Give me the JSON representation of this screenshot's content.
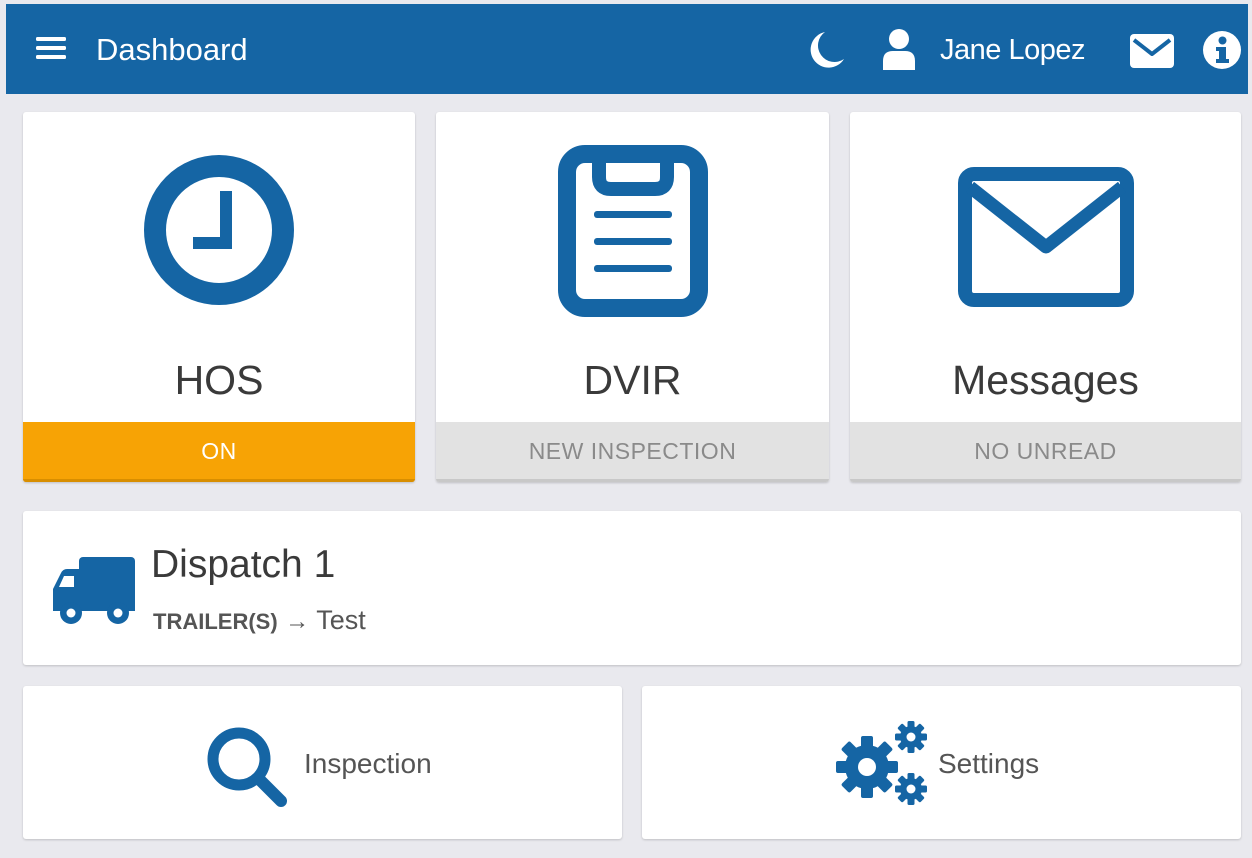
{
  "header": {
    "title": "Dashboard",
    "user_name": "Jane Lopez",
    "background_color": "#1565a4",
    "icons": [
      "menu-icon",
      "moon-icon",
      "user-icon",
      "envelope-icon",
      "info-icon"
    ]
  },
  "tiles": [
    {
      "label": "HOS",
      "status": "ON",
      "icon": "clock-icon",
      "status_color": "#f7a305"
    },
    {
      "label": "DVIR",
      "status": "NEW INSPECTION",
      "icon": "clipboard-icon",
      "status_color": "#e2e2e2"
    },
    {
      "label": "Messages",
      "status": "NO UNREAD",
      "icon": "envelope-icon",
      "status_color": "#e2e2e2"
    }
  ],
  "dispatch": {
    "title": "Dispatch 1",
    "trailer_label": "TRAILER(S)",
    "arrow": "→",
    "trailer_value": "Test",
    "icon": "truck-icon"
  },
  "actions": [
    {
      "label": "Inspection",
      "icon": "search-icon"
    },
    {
      "label": "Settings",
      "icon": "gears-icon"
    }
  ],
  "colors": {
    "primary": "#1565a4",
    "accent": "#f7a305",
    "page_background": "#e9e9ee",
    "muted_status": "#e2e2e2"
  }
}
